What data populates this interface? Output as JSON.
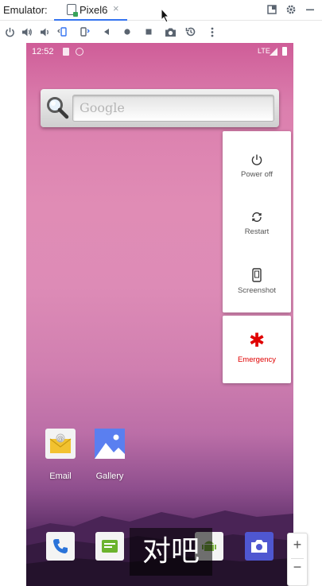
{
  "window": {
    "emulator_label": "Emulator:",
    "tab_label": "Pixel6",
    "tab_close": "×"
  },
  "toolbar": {
    "icons": [
      "power-icon",
      "volume-up-icon",
      "volume-down-icon",
      "rotate-left-icon",
      "rotate-right-icon",
      "back-icon",
      "home-icon",
      "overview-icon",
      "camera-icon",
      "snapshot-icon",
      "more-icon"
    ]
  },
  "status_bar": {
    "time": "12:52",
    "network": "LTE"
  },
  "search_widget": {
    "placeholder": "Google"
  },
  "power_menu": {
    "items": [
      {
        "label": "Power off",
        "icon": "power-icon"
      },
      {
        "label": "Restart",
        "icon": "restart-icon"
      },
      {
        "label": "Screenshot",
        "icon": "screenshot-icon"
      }
    ],
    "emergency": {
      "label": "Emergency",
      "icon": "emergency-asterisk-icon"
    }
  },
  "home_apps": [
    {
      "label": "Email",
      "icon": "email-icon"
    },
    {
      "label": "Gallery",
      "icon": "gallery-icon"
    }
  ],
  "dock": [
    "phone-icon",
    "messaging-icon",
    "android-icon",
    "camera-icon"
  ],
  "overlay_subtitle": "对吧",
  "zoom": {
    "plus": "+",
    "minus": "−"
  },
  "colors": {
    "accent_tab_underline": "#3574f0",
    "emergency_red": "#e00000",
    "wallpaper_top": "#cf5d98",
    "wallpaper_bottom": "#3d1d49"
  }
}
